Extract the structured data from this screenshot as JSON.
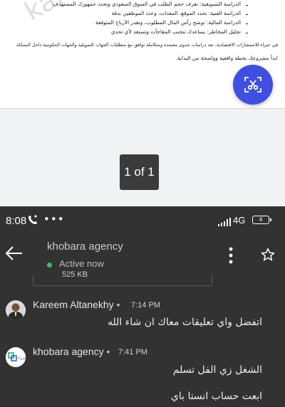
{
  "document": {
    "watermark": "kare",
    "lines": [
      "الدراسة التسويقية: تعرف حجم الطلب في السوق السعودي وتحدد جمهورك المستهدف",
      "الدراسة الفنية: تحدد الموقع، المعدات، وعدد الموظفين بدقة",
      "الدراسة المالية: توضح رأس المال المطلوب، وتقدر الأرباح المتوقعة",
      "تحليل المخاطر: يساعدك تتجنب المفاجآت وتستعد لأي تحدي",
      "في خبراء للاستشارات الاقتصادية، نعد دراسات جدوى معتمدة ومتكاملة توافق مع متطلبات الجهات التمويلية والجهات الحكومية داخل المملكة",
      "ابدأ مشروعك بخطة واقعية وواضحة من البداية."
    ],
    "page_indicator": "1 of 1",
    "fab_icon": "scissors-scan-icon",
    "fab_color": "#3f4fe0"
  },
  "status_bar": {
    "time": "8:08",
    "call_icon": "phone-call-icon",
    "overflow": "•••",
    "network": "4G",
    "battery": "4"
  },
  "header": {
    "contact_name": "khobara agency",
    "presence": "Active now",
    "presence_color": "#36c26b"
  },
  "previous_attachment": {
    "size": "525 KB"
  },
  "messages": [
    {
      "sender": "Kareem Altanekhy",
      "time": "7:14 PM",
      "lines": [
        "اتفضل واي تعليقات معاك ان شاء الله"
      ]
    },
    {
      "sender": "khobara agency",
      "time": "7:41 PM",
      "avatar_text": "خبراء",
      "lines": [
        "الشغل زي الفل تسلم",
        "ابعت حساب انستا باي"
      ]
    }
  ]
}
